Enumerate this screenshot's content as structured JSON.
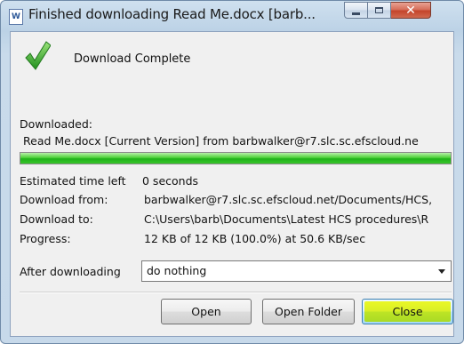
{
  "window": {
    "title": "Finished downloading Read Me.docx [barb...",
    "title_icon": "word-document-icon",
    "caption_buttons": {
      "minimize": "minimize-icon",
      "maximize": "maximize-icon",
      "close": "close-icon"
    }
  },
  "status": {
    "icon": "checkmark-icon",
    "icon_color": "#3db83a",
    "message": "Download Complete"
  },
  "download": {
    "downloaded_label": "Downloaded:",
    "file_line": "Read Me.docx [Current Version] from barbwalker@r7.slc.sc.efscloud.ne",
    "progress_fraction": 1.0,
    "progress_color": "#22b81c"
  },
  "info": {
    "rows": [
      {
        "label": "Estimated time left",
        "value": "0 seconds"
      },
      {
        "label": "Download from:",
        "value": "barbwalker@r7.slc.sc.efscloud.net/Documents/HCS,"
      },
      {
        "label": "Download to:",
        "value": "C:\\Users\\barb\\Documents\\Latest HCS procedures\\R"
      },
      {
        "label": "Progress:",
        "value": "12 KB of 12 KB (100.0%) at 50.6 KB/sec"
      }
    ]
  },
  "after": {
    "label": "After downloading",
    "selected": "do nothing"
  },
  "buttons": {
    "open": "Open",
    "open_folder": "Open Folder",
    "close": "Close",
    "close_highlight_color": "#ffff00"
  }
}
